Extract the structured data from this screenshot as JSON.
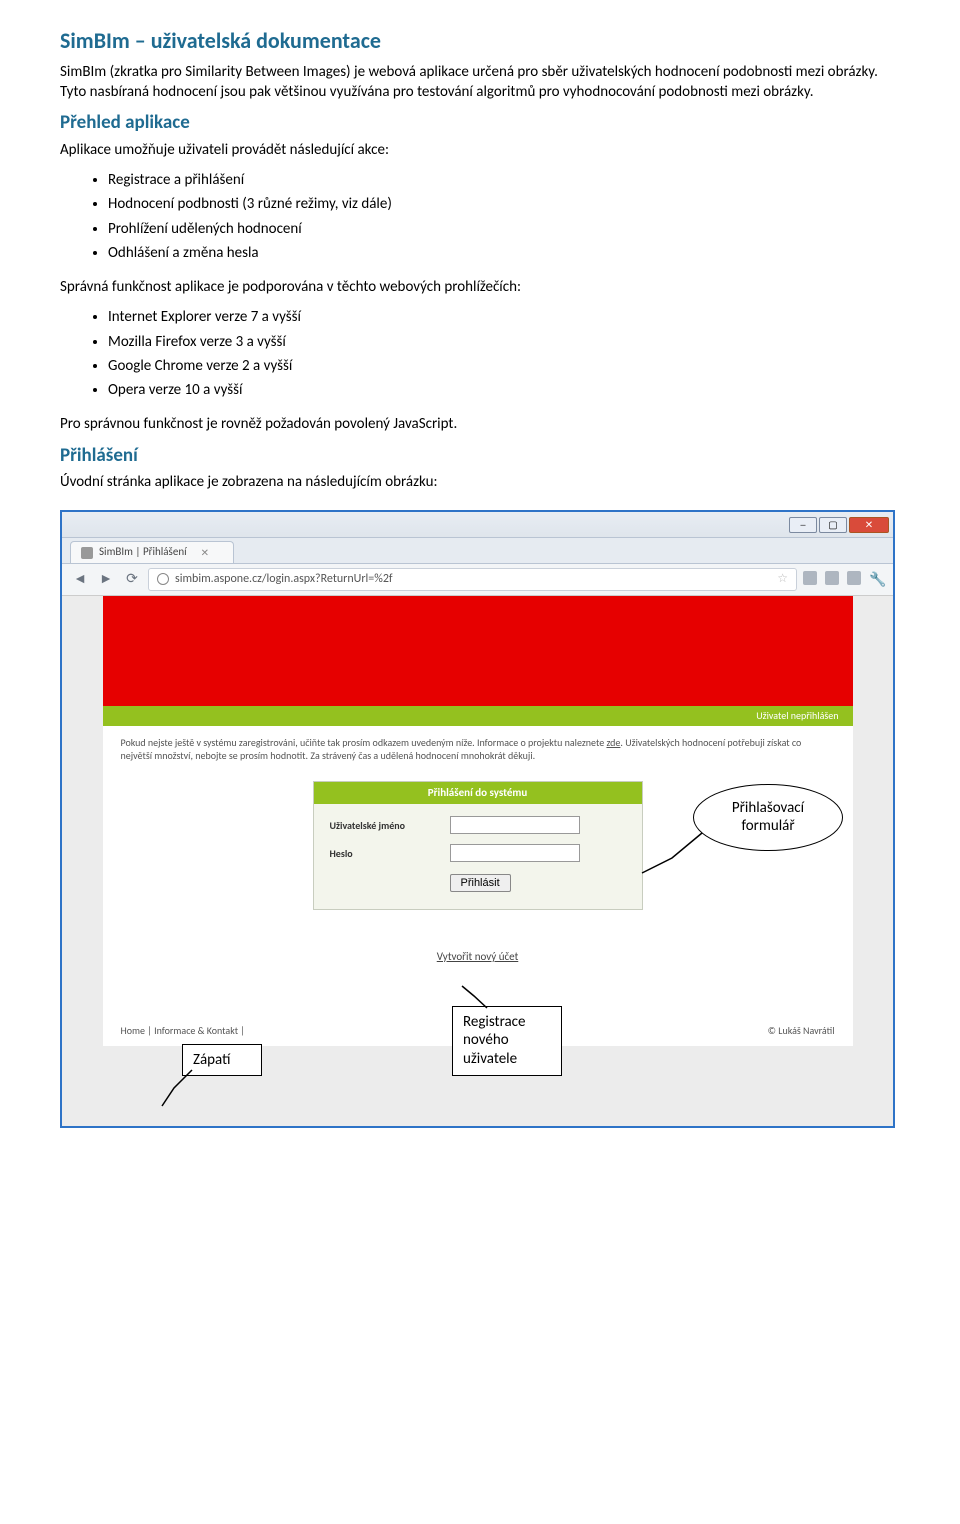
{
  "doc": {
    "title": "SimBIm – uživatelská dokumentace",
    "intro1": "SimBIm (zkratka pro Similarity Between Images) je webová aplikace určená pro sběr uživatelských hodnocení podobnosti mezi obrázky. Tyto nasbíraná hodnocení jsou pak většinou využívána pro testování algoritmů pro vyhodnocování podobnosti mezi obrázky.",
    "section_overview_title": "Přehled aplikace",
    "overview_lead": "Aplikace umožňuje uživateli provádět následující akce:",
    "actions": [
      "Registrace a přihlášení",
      "Hodnocení podbnosti (3 různé režimy, viz dále)",
      "Prohlížení udělených hodnocení",
      "Odhlášení a změna hesla"
    ],
    "browsers_lead": "Správná funkčnost aplikace je podporována v těchto webových prohlížečích:",
    "browsers": [
      "Internet Explorer verze 7 a vyšší",
      "Mozilla Firefox verze 3 a vyšší",
      "Google Chrome verze 2 a vyšší",
      "Opera verze 10 a vyšší"
    ],
    "js_note": "Pro správnou funkčnost je rovněž požadován povolený JavaScript.",
    "section_login_title": "Přihlášení",
    "login_lead": "Úvodní stránka aplikace je zobrazena na následujícím obrázku:"
  },
  "browser": {
    "tab_title": "SimBIm | Přihlášení",
    "url": "simbim.aspone.cz/login.aspx?ReturnUrl=%2f"
  },
  "page": {
    "status_right": "Uživatel nepřihlášen",
    "info_text_1": "Pokud nejste ještě v systému zaregistrováni, učiňte tak prosím odkazem uvedeným níže. Informace o projektu naleznete ",
    "info_link": "zde",
    "info_text_2": ". Uživatelských hodnocení potřebuji získat co největší množství, nebojte se prosím hodnotit. Za strávený čas a udělená hodnocení mnohokrát děkuji.",
    "login_header": "Přihlášení do systému",
    "label_username": "Uživatelské jméno",
    "label_password": "Heslo",
    "button_login": "Přihlásit",
    "create_account": "Vytvořit nový účet",
    "footer_left": "Home | Informace & Kontakt |",
    "footer_right": "© Lukáš Navrátil"
  },
  "callouts": {
    "login_form": "Přihlašovací formulář",
    "register": "Registrace nového uživatele",
    "footer": "Zápatí"
  }
}
